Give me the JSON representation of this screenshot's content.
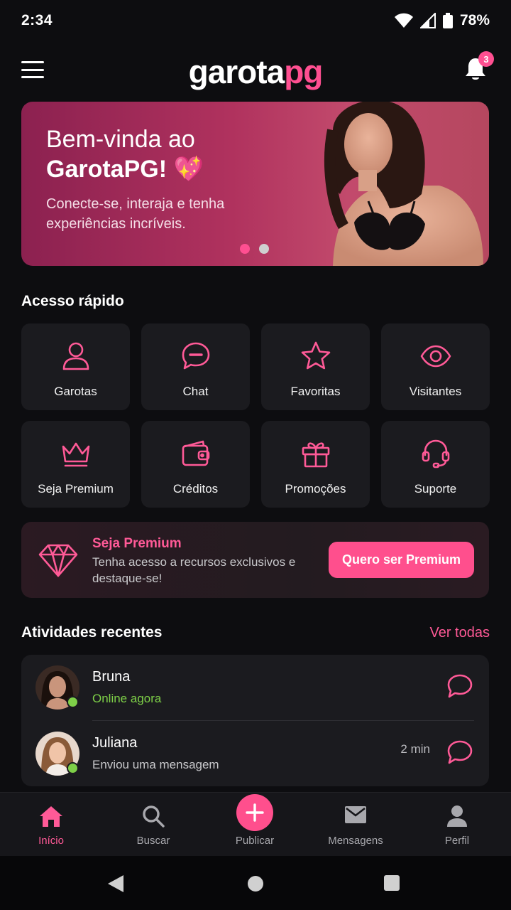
{
  "status_bar": {
    "time": "2:34",
    "battery": "78%"
  },
  "app_bar": {
    "logo_main": "garota",
    "logo_accent": "pg",
    "notification_count": "3"
  },
  "hero": {
    "title_line1": "Bem-vinda ao",
    "title_line2": "GarotaPG! 💖",
    "subtitle": "Conecte-se, interaja e tenha experiências incríveis.",
    "slide_count": 2,
    "active_slide": 1
  },
  "quick_access": {
    "title": "Acesso rápido",
    "items": [
      {
        "label": "Garotas",
        "icon": "person-icon"
      },
      {
        "label": "Chat",
        "icon": "chat-icon"
      },
      {
        "label": "Favoritas",
        "icon": "star-icon"
      },
      {
        "label": "Visitantes",
        "icon": "eye-icon"
      },
      {
        "label": "Seja Premium",
        "icon": "crown-icon"
      },
      {
        "label": "Créditos",
        "icon": "wallet-icon"
      },
      {
        "label": "Promoções",
        "icon": "gift-icon"
      },
      {
        "label": "Suporte",
        "icon": "headset-icon"
      }
    ]
  },
  "premium": {
    "title": "Seja Premium",
    "description": "Tenha acesso a recursos exclusivos e destaque-se!",
    "button": "Quero ser Premium",
    "icon": "diamond-icon"
  },
  "recent": {
    "title": "Atividades recentes",
    "see_all": "Ver todas",
    "items": [
      {
        "name": "Bruna",
        "status": "Online agora",
        "time": ""
      },
      {
        "name": "Juliana",
        "status": "Enviou uma mensagem",
        "time": "2 min"
      }
    ]
  },
  "bottom_nav": {
    "items": [
      {
        "label": "Início",
        "icon": "home-icon",
        "active": true
      },
      {
        "label": "Buscar",
        "icon": "search-icon"
      },
      {
        "label": "Publicar",
        "icon": "plus-icon"
      },
      {
        "label": "Mensagens",
        "icon": "mail-icon"
      },
      {
        "label": "Perfil",
        "icon": "user-icon"
      }
    ]
  },
  "colors": {
    "accent": "#ff4f8d",
    "background": "#0d0d10",
    "card": "#1b1b1f",
    "online": "#7ed048"
  }
}
